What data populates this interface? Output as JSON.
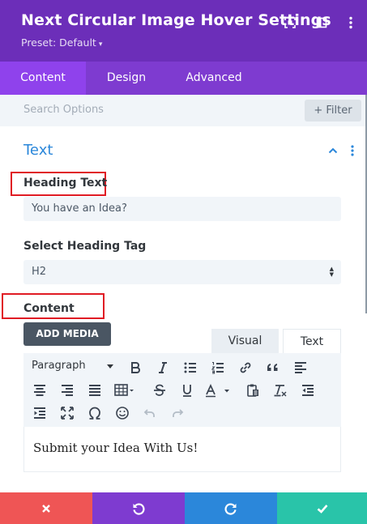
{
  "header": {
    "title": "Next Circular Image Hover Settings",
    "preset_label": "Preset: Default",
    "icons": [
      "screenshot-focus-icon",
      "sidebar-split-icon",
      "more-vertical-icon"
    ]
  },
  "tabs": [
    {
      "label": "Content",
      "active": true
    },
    {
      "label": "Design",
      "active": false
    },
    {
      "label": "Advanced",
      "active": false
    }
  ],
  "search": {
    "placeholder": "Search Options",
    "filter_label": "+ Filter"
  },
  "section": {
    "title": "Text"
  },
  "fields": {
    "heading_text_label": "Heading Text",
    "heading_text_value": "You have an Idea?",
    "heading_tag_label": "Select Heading Tag",
    "heading_tag_value": "H2",
    "content_label": "Content"
  },
  "editor": {
    "add_media_label": "ADD MEDIA",
    "tab_visual": "Visual",
    "tab_text": "Text",
    "paragraph_format": "Paragraph",
    "content": "Submit your Idea With Us!"
  },
  "footer": {
    "buttons": [
      {
        "name": "discard",
        "color": "#ef5555"
      },
      {
        "name": "undo",
        "color": "#7e3bd0"
      },
      {
        "name": "redo",
        "color": "#2b87da"
      },
      {
        "name": "save",
        "color": "#29c4a9"
      }
    ]
  },
  "colors": {
    "accent_purple": "#6c2eb9",
    "section_blue": "#2b87da",
    "highlight_red": "#e01b24"
  }
}
